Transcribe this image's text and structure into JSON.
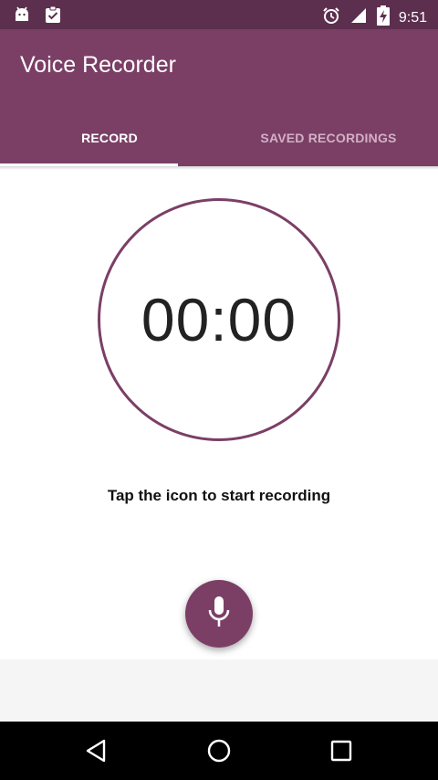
{
  "status_bar": {
    "time": "9:51",
    "left_icons": [
      "android-icon",
      "clipboard-check-icon"
    ],
    "right_icons": [
      "alarm-icon",
      "signal-icon",
      "battery-charging-icon"
    ]
  },
  "app_bar": {
    "title": "Voice Recorder",
    "tabs": [
      {
        "label": "RECORD",
        "active": true
      },
      {
        "label": "SAVED RECORDINGS",
        "active": false
      }
    ]
  },
  "record": {
    "timer": "00:00",
    "hint": "Tap the icon to start recording",
    "fab_icon": "microphone-icon"
  },
  "nav_bar": {
    "buttons": [
      "back-icon",
      "home-icon",
      "recents-icon"
    ]
  },
  "colors": {
    "primary": "#7b3f66",
    "primary_dark": "#5c2f4f",
    "tab_inactive": "#d2b0c5"
  }
}
